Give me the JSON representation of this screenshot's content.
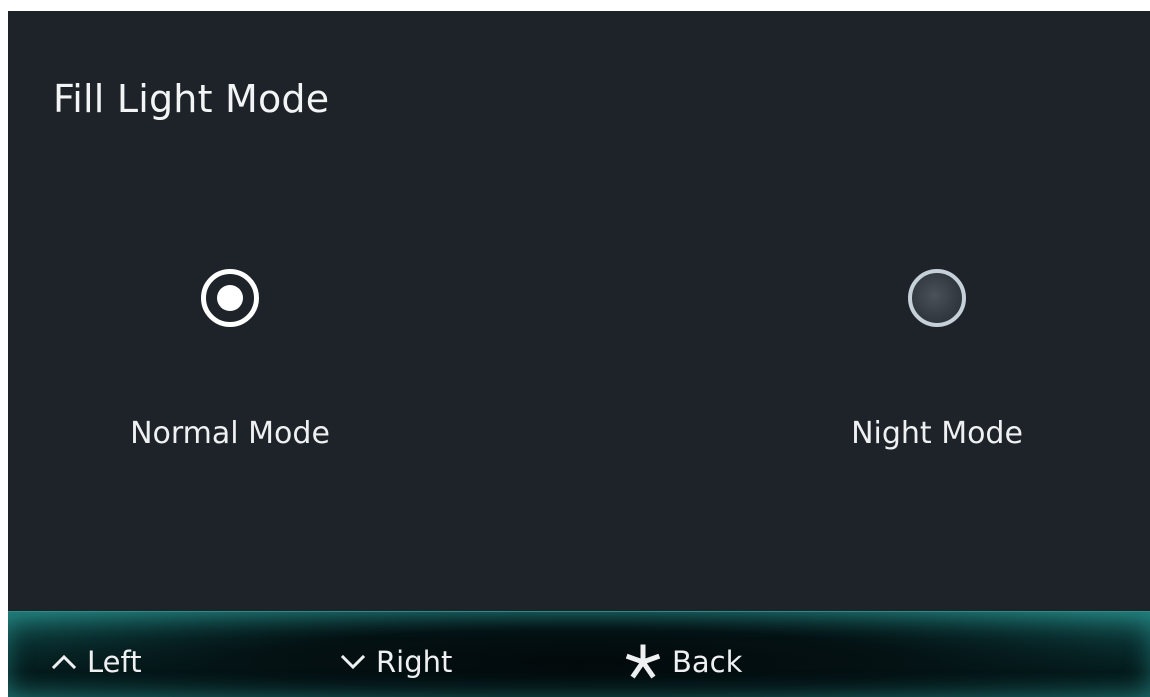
{
  "page": {
    "title": "Fill Light Mode"
  },
  "options": [
    {
      "label": "Normal Mode",
      "selected": true
    },
    {
      "label": "Night Mode",
      "selected": false
    }
  ],
  "footer": {
    "left": {
      "icon": "chevron-up-icon",
      "label": "Left"
    },
    "right": {
      "icon": "chevron-down-icon",
      "label": "Right"
    },
    "back": {
      "icon": "asterisk-icon",
      "label": "Back"
    }
  },
  "colors": {
    "background": "#1d2329",
    "text": "#eef0f2",
    "footer_accent": "#1c6b69"
  }
}
